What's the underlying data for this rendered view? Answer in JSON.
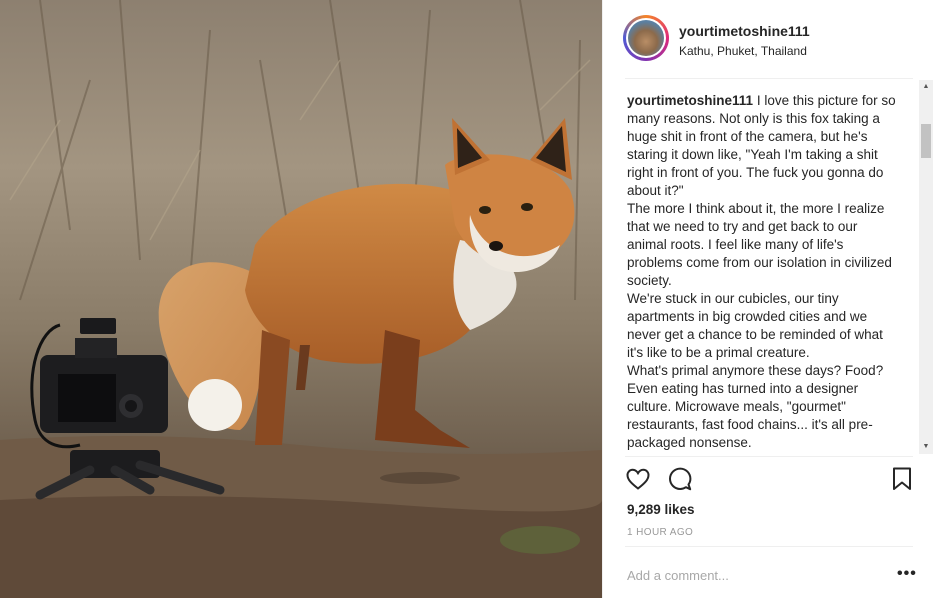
{
  "post": {
    "username": "yourtimetoshine111",
    "location": "Kathu, Phuket, Thailand",
    "caption_user": "yourtimetoshine111",
    "caption_text": "I love this picture for so many reasons. Not only is this fox taking a huge shit in front of the camera, but he's staring it down like, \"Yeah I'm taking a shit right in front of you. The fuck you gonna do about it?\"",
    "caption_paragraphs": [
      "The more I think about it, the more I realize that we need to try and get back to our animal roots. I feel like many of life's problems come from our isolation in civilized society.",
      "We're stuck in our cubicles, our tiny apartments in big crowded cities and we never get a chance to be reminded of what it's like to be a primal creature.",
      "What's primal anymore these days? Food? Even eating has turned into a designer culture. Microwave meals, \"gourmet\" restaurants, fast food chains... it's all pre-packaged nonsense."
    ],
    "likes": "9,289 likes",
    "time": "1 HOUR AGO",
    "comment_placeholder": "Add a comment...",
    "more_label": "•••"
  },
  "icons": {
    "like": "heart-icon",
    "comment": "speech-bubble-icon",
    "save": "bookmark-icon",
    "scroll_up": "up-arrow-icon",
    "scroll_down": "down-arrow-icon"
  },
  "colors": {
    "text": "#262626",
    "muted": "#999999",
    "divider": "#efefef",
    "story_ring": "#dd2a7b"
  }
}
